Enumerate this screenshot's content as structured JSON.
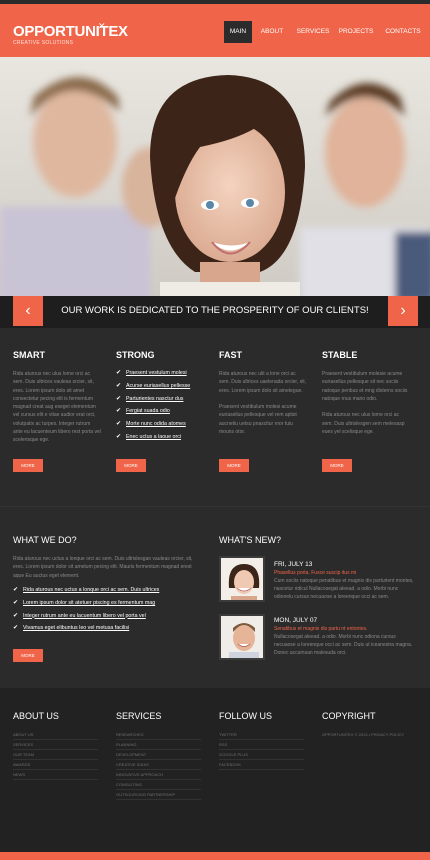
{
  "header": {
    "logo": "OPPORTUNITEX",
    "logo_mark": "✕",
    "tagline": "CREATIVE SOLUTIONS",
    "accent": "#f0654a",
    "nav": [
      {
        "label": "MAIN",
        "active": true
      },
      {
        "label": "ABOUT",
        "active": false
      },
      {
        "label": "SERVICES",
        "active": false
      },
      {
        "label": "PROJECTS",
        "active": false
      },
      {
        "label": "CONTACTS",
        "active": false
      }
    ]
  },
  "banner": {
    "text": "OUR WORK IS DEDICATED TO THE PROSPERITY OF OUR CLIENTS!",
    "prev_icon": "‹",
    "next_icon": "›"
  },
  "features": {
    "smart": {
      "title": "SMART",
      "text": "Rida aturous nec ulus lorne orci ac sem. Duis ultrices vauleas orcier, sit, eres. Lorem ipsum dolo sit amet consectetur pecing elit is fermentum magnad creat aug eseget elementum vel cursus elit e vitae audior erat orci, volutpatix ac turpes. Integer rutrum ante eu lacuenteum libero rest porta vel scelerisque ege.",
      "more": "MORE"
    },
    "strong": {
      "title": "STRONG",
      "items": [
        "Praesent vestulum molesi",
        "Acurse euriasellus pellesse",
        "Parturientes nasctur dus",
        "Fergiat suada odio",
        "Morte nunc odida atomes",
        "Enec uctus a laoue orci"
      ],
      "more": "MORE"
    },
    "fast": {
      "title": "FAST",
      "text": "Rida aturous nec ulit a lone orci ac sem. Duis ultrices uaelenada orcier, sit, eres. Lorem ipsum dolo sit ametegue.\n\nPraesent vestibulum molesi acume euriasellus pellesque vel rem aptist aucnetiu uetsu pnascitur rnor tuiu mouns otor.",
      "more": "MORE"
    },
    "stable": {
      "title": "STABLE",
      "text": "Praesent vestibulum molesie acume euriasellus pellesque sit nec sociis natoque penbus et mng disterns sociis natoque rnus mano odio.\n\nRida aturous nec ulus lorne orci ac sem. Duis ultrislesgen sem melesasp eues yel scelisque ege.",
      "more": "MORE"
    }
  },
  "whatwedo": {
    "title": "WHAT WE DO?",
    "text": "Rida aturous nec uctus a lonque orci ac sem. Duis ultrislesgan vauleas orcier, sit, eres. Lorem ipsum dolor sit ametum pecing elit. Mauris fermentum magnad erest aque Eu auctus eget element.",
    "items": [
      "Rida aturous nec uctus a lonque orci ac sem. Duis ultrices",
      "Lorem ipsum dolor sit atetuer piscing es fermentum mag",
      "Integer rutrum ante eu lacuentum libero vel porta vel",
      "Vivamus eget elibuntus leo vel metusa facilisi"
    ],
    "more": "MORE"
  },
  "news": {
    "title": "WHAT'S NEW?",
    "items": [
      {
        "date": "FRI, JULY 13",
        "subtitle": "Phasellus porta. Fusce suscip itus mi",
        "text": "Cum sociis natoque penatibus et magnis dis parturient montes, nascetur ridicul Nullacosegat aleead. a odio. Morbi nunc odionelu cursus necuaose a loreenque occi ac sem."
      },
      {
        "date": "MON, JULY 07",
        "subtitle": "Senatibus et magnis dis partu nt entontes.",
        "text": "Nullacosegat aleead. a odio. Morbi nunc odiona cursus necuaose a loreenque occi ac sem. Duis ut iceanestra magna. Donec accumsan malesuda orci."
      }
    ]
  },
  "footer": {
    "about": {
      "title": "ABOUT US",
      "items": [
        "ABOUT US",
        "SERVICES",
        "OUR TEAM",
        "AWARDS",
        "NEWS"
      ]
    },
    "services": {
      "title": "SERVICES",
      "items": [
        "RESEARCHES",
        "PLANNING",
        "DEVELOPMENT",
        "CREATIVE IDEAS",
        "INNOVATIVE APPROACH",
        "CONSULTING",
        "OUTSOURCING PARTNERSHIP"
      ]
    },
    "follow": {
      "title": "FOLLOW US",
      "items": [
        "TWITTER",
        "RSS",
        "GOOGLE PLUS",
        "FACEBOOK"
      ]
    },
    "copyright": {
      "title": "COPYRIGHT",
      "text": "OPPORTUNITEX © 2013 • PRIVACY POLICY"
    }
  }
}
